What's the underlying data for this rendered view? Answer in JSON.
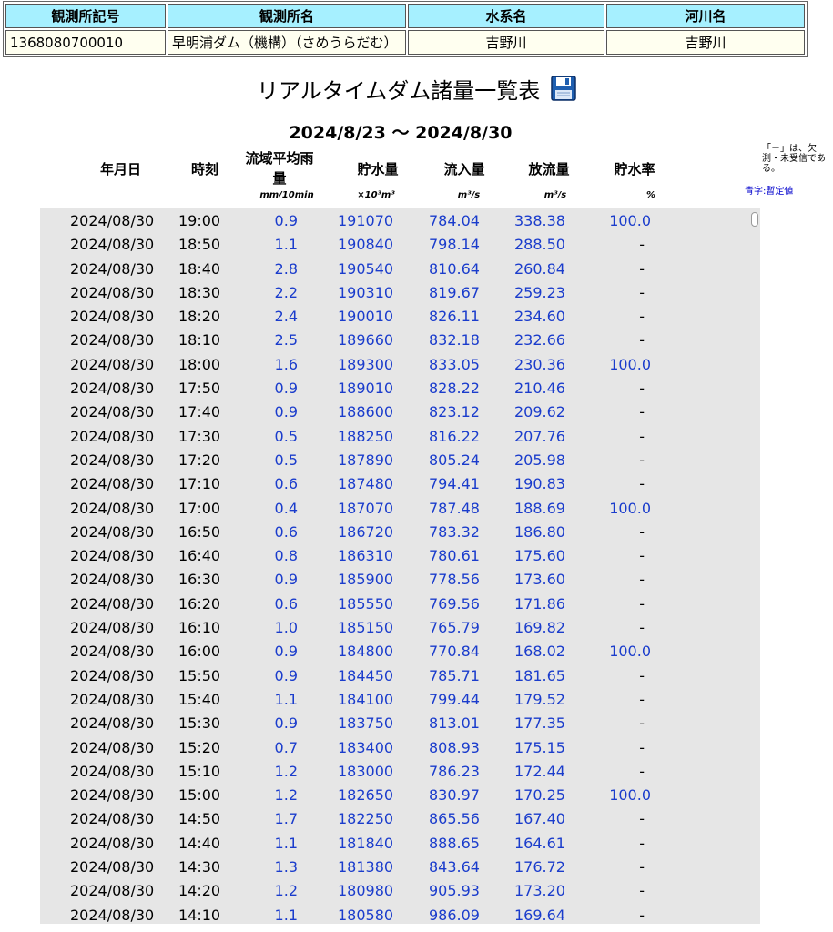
{
  "station": {
    "headers": [
      "観測所記号",
      "観測所名",
      "水系名",
      "河川名"
    ],
    "code": "1368080700010",
    "name": "早明浦ダム（機構）（さめうらだむ）",
    "system": "吉野川",
    "river": "吉野川"
  },
  "title": "リアルタイムダム諸量一覧表",
  "save_icon": "floppy-disk-icon",
  "period": "2024/8/23 ～ 2024/8/30",
  "table": {
    "headers": {
      "date": "年月日",
      "time": "時刻",
      "rain": "流域平均雨量",
      "storage": "貯水量",
      "inflow": "流入量",
      "outflow": "放流量",
      "rate": "貯水率"
    },
    "units": {
      "rain": "mm/10min",
      "storage": "×10³m³",
      "inflow": "m³/s",
      "outflow": "m³/s",
      "rate": "%"
    },
    "note": "「－」は、欠測・未受信である。",
    "note_color_label": "青字:暫定値"
  },
  "rows": [
    [
      "2024/08/30",
      "19:00",
      "0.9",
      "191070",
      "784.04",
      "338.38",
      "100.0"
    ],
    [
      "2024/08/30",
      "18:50",
      "1.1",
      "190840",
      "798.14",
      "288.50",
      "-"
    ],
    [
      "2024/08/30",
      "18:40",
      "2.8",
      "190540",
      "810.64",
      "260.84",
      "-"
    ],
    [
      "2024/08/30",
      "18:30",
      "2.2",
      "190310",
      "819.67",
      "259.23",
      "-"
    ],
    [
      "2024/08/30",
      "18:20",
      "2.4",
      "190010",
      "826.11",
      "234.60",
      "-"
    ],
    [
      "2024/08/30",
      "18:10",
      "2.5",
      "189660",
      "832.18",
      "232.66",
      "-"
    ],
    [
      "2024/08/30",
      "18:00",
      "1.6",
      "189300",
      "833.05",
      "230.36",
      "100.0"
    ],
    [
      "2024/08/30",
      "17:50",
      "0.9",
      "189010",
      "828.22",
      "210.46",
      "-"
    ],
    [
      "2024/08/30",
      "17:40",
      "0.9",
      "188600",
      "823.12",
      "209.62",
      "-"
    ],
    [
      "2024/08/30",
      "17:30",
      "0.5",
      "188250",
      "816.22",
      "207.76",
      "-"
    ],
    [
      "2024/08/30",
      "17:20",
      "0.5",
      "187890",
      "805.24",
      "205.98",
      "-"
    ],
    [
      "2024/08/30",
      "17:10",
      "0.6",
      "187480",
      "794.41",
      "190.83",
      "-"
    ],
    [
      "2024/08/30",
      "17:00",
      "0.4",
      "187070",
      "787.48",
      "188.69",
      "100.0"
    ],
    [
      "2024/08/30",
      "16:50",
      "0.6",
      "186720",
      "783.32",
      "186.80",
      "-"
    ],
    [
      "2024/08/30",
      "16:40",
      "0.8",
      "186310",
      "780.61",
      "175.60",
      "-"
    ],
    [
      "2024/08/30",
      "16:30",
      "0.9",
      "185900",
      "778.56",
      "173.60",
      "-"
    ],
    [
      "2024/08/30",
      "16:20",
      "0.6",
      "185550",
      "769.56",
      "171.86",
      "-"
    ],
    [
      "2024/08/30",
      "16:10",
      "1.0",
      "185150",
      "765.79",
      "169.82",
      "-"
    ],
    [
      "2024/08/30",
      "16:00",
      "0.9",
      "184800",
      "770.84",
      "168.02",
      "100.0"
    ],
    [
      "2024/08/30",
      "15:50",
      "0.9",
      "184450",
      "785.71",
      "181.65",
      "-"
    ],
    [
      "2024/08/30",
      "15:40",
      "1.1",
      "184100",
      "799.44",
      "179.52",
      "-"
    ],
    [
      "2024/08/30",
      "15:30",
      "0.9",
      "183750",
      "813.01",
      "177.35",
      "-"
    ],
    [
      "2024/08/30",
      "15:20",
      "0.7",
      "183400",
      "808.93",
      "175.15",
      "-"
    ],
    [
      "2024/08/30",
      "15:10",
      "1.2",
      "183000",
      "786.23",
      "172.44",
      "-"
    ],
    [
      "2024/08/30",
      "15:00",
      "1.2",
      "182650",
      "830.97",
      "170.25",
      "100.0"
    ],
    [
      "2024/08/30",
      "14:50",
      "1.7",
      "182250",
      "865.56",
      "167.40",
      "-"
    ],
    [
      "2024/08/30",
      "14:40",
      "1.1",
      "181840",
      "888.65",
      "164.61",
      "-"
    ],
    [
      "2024/08/30",
      "14:30",
      "1.3",
      "181380",
      "843.64",
      "176.72",
      "-"
    ],
    [
      "2024/08/30",
      "14:20",
      "1.2",
      "180980",
      "905.93",
      "173.20",
      "-"
    ],
    [
      "2024/08/30",
      "14:10",
      "1.1",
      "180580",
      "986.09",
      "169.64",
      "-"
    ]
  ]
}
